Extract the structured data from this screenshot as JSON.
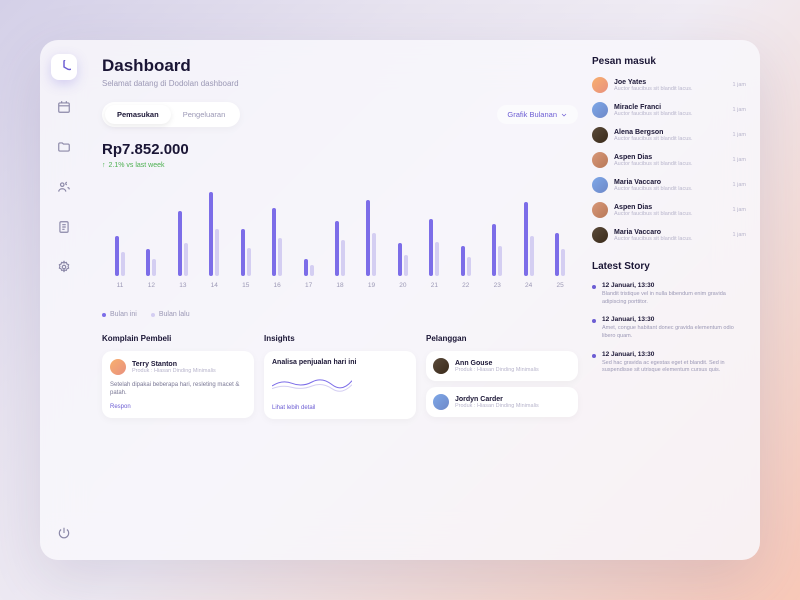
{
  "header": {
    "title": "Dashboard",
    "subtitle": "Selamat datang di Dodolan dashboard"
  },
  "tabs": {
    "income": "Pemasukan",
    "expense": "Pengeluaran"
  },
  "dropdown": {
    "label": "Grafik Bulanan"
  },
  "summary": {
    "amount": "Rp7.852.000",
    "trend": "2.1% vs last week"
  },
  "legend": {
    "current": "Bulan ini",
    "previous": "Bulan lalu"
  },
  "chart_data": {
    "type": "bar",
    "categories": [
      "11",
      "12",
      "13",
      "14",
      "15",
      "16",
      "17",
      "18",
      "19",
      "20",
      "21",
      "22",
      "23",
      "24",
      "25"
    ],
    "series": [
      {
        "name": "Bulan ini",
        "values": [
          42,
          28,
          68,
          88,
          50,
          72,
          18,
          58,
          80,
          35,
          60,
          32,
          55,
          78,
          45
        ]
      },
      {
        "name": "Bulan lalu",
        "values": [
          25,
          18,
          35,
          50,
          30,
          40,
          12,
          38,
          45,
          22,
          36,
          20,
          32,
          42,
          28
        ]
      }
    ],
    "ylim": [
      0,
      100
    ]
  },
  "complaints": {
    "title": "Komplain Pembeli",
    "name": "Terry Stanton",
    "sub": "Produk : Hiasan Dinding Minimalis",
    "text": "Setelah dipakai beberapa hari, resleting macet & patah.",
    "action": "Respon"
  },
  "insights": {
    "title": "Insights",
    "heading": "Analisa penjualan hari ini",
    "action": "Lihat lebih detail"
  },
  "customers": {
    "title": "Pelanggan",
    "items": [
      {
        "name": "Ann Gouse",
        "sub": "Produk : Hiasan Dinding Minimalis"
      },
      {
        "name": "Jordyn Carder",
        "sub": "Produk : Hiasan Dinding Minimalis"
      }
    ]
  },
  "inbox": {
    "title": "Pesan masuk",
    "items": [
      {
        "name": "Joe Yates",
        "sub": "Auctor faucibus sit blandit lacus.",
        "time": "1 jam"
      },
      {
        "name": "Miracle Franci",
        "sub": "Auctor faucibus sit blandit lacus.",
        "time": "1 jam"
      },
      {
        "name": "Alena Bergson",
        "sub": "Auctor faucibus sit blandit lacus.",
        "time": "1 jam"
      },
      {
        "name": "Aspen Dias",
        "sub": "Auctor faucibus sit blandit lacus.",
        "time": "1 jam"
      },
      {
        "name": "Maria Vaccaro",
        "sub": "Auctor faucibus sit blandit lacus.",
        "time": "1 jam"
      },
      {
        "name": "Aspen Dias",
        "sub": "Auctor faucibus sit blandit lacus.",
        "time": "1 jam"
      },
      {
        "name": "Maria Vaccaro",
        "sub": "Auctor faucibus sit blandit lacus.",
        "time": "1 jam"
      }
    ]
  },
  "stories": {
    "title": "Latest Story",
    "items": [
      {
        "date": "12 Januari, 13:30",
        "text": "Blandit tristique vel in nulla bibendum enim gravida adipiscing porttitor."
      },
      {
        "date": "12 Januari, 13:30",
        "text": "Amet, congue habitant donec gravida elementum odio libero quam."
      },
      {
        "date": "12 Januari, 13:30",
        "text": "Sed hac gravida ac egestas eget et blandit. Sed in suspendisse sit utrisque elementum cursus quis."
      }
    ]
  }
}
